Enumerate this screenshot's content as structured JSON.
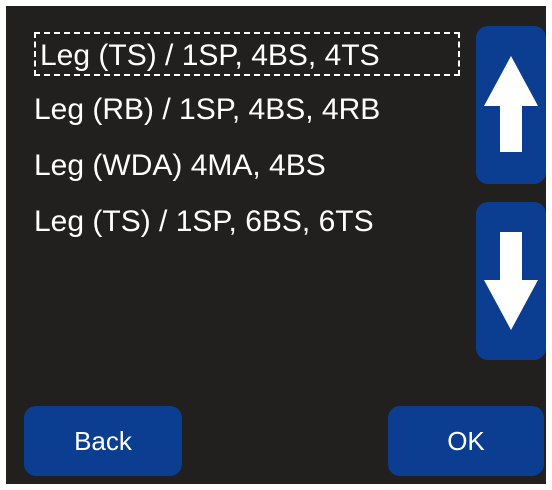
{
  "list": {
    "items": [
      {
        "label": "Leg (TS) / 1SP, 4BS, 4TS",
        "selected": true
      },
      {
        "label": "Leg (RB) / 1SP, 4BS, 4RB",
        "selected": false
      },
      {
        "label": "Leg (WDA) 4MA, 4BS",
        "selected": false
      },
      {
        "label": "Leg (TS) / 1SP, 6BS, 6TS",
        "selected": false
      }
    ]
  },
  "scroll": {
    "up_icon": "arrow-up-icon",
    "down_icon": "arrow-down-icon"
  },
  "footer": {
    "back_label": "Back",
    "ok_label": "OK"
  },
  "colors": {
    "background": "#221f1f",
    "button": "#0b3d91",
    "text": "#ffffff"
  }
}
